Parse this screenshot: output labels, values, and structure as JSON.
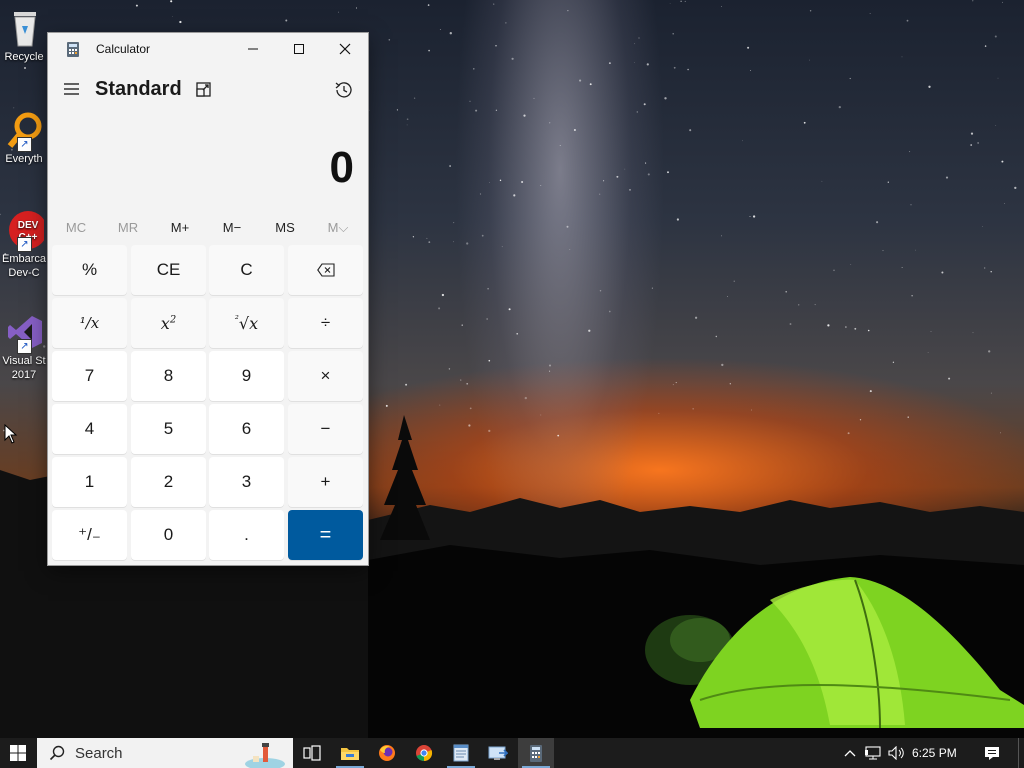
{
  "desktop": {
    "icons": [
      {
        "label": "Recycle",
        "name": "recycle-bin"
      },
      {
        "label": "Everyth",
        "name": "everything"
      },
      {
        "label": "Embarca",
        "label2": "Dev-C",
        "name": "embarcadero-dev-cpp"
      },
      {
        "label": "Visual St",
        "label2": "2017",
        "name": "visual-studio-2017"
      }
    ]
  },
  "calculator": {
    "window_title": "Calculator",
    "mode": "Standard",
    "display": "0",
    "memory": [
      "MC",
      "MR",
      "M+",
      "M−",
      "MS",
      "M⌵"
    ],
    "keys": {
      "percent": "%",
      "ce": "CE",
      "c": "C",
      "backspace": "⌫",
      "reciprocal_num": "¹",
      "reciprocal_x": "x",
      "square_x": "x",
      "square_exp": "2",
      "sqrt_idx": "²",
      "sqrt_x": "x",
      "divide": "÷",
      "seven": "7",
      "eight": "8",
      "nine": "9",
      "multiply": "×",
      "four": "4",
      "five": "5",
      "six": "6",
      "minus": "−",
      "one": "1",
      "two": "2",
      "three": "3",
      "plus": "+",
      "negate": "⁺/₋",
      "zero": "0",
      "decimal": ".",
      "equals": "="
    },
    "accent_color": "#005a9e"
  },
  "taskbar": {
    "search_placeholder": "Search",
    "apps": [
      "task-view",
      "file-explorer",
      "firefox",
      "chrome",
      "notepad",
      "remote-desktop",
      "calculator"
    ],
    "active_app": "calculator",
    "clock": "6:25 PM"
  }
}
